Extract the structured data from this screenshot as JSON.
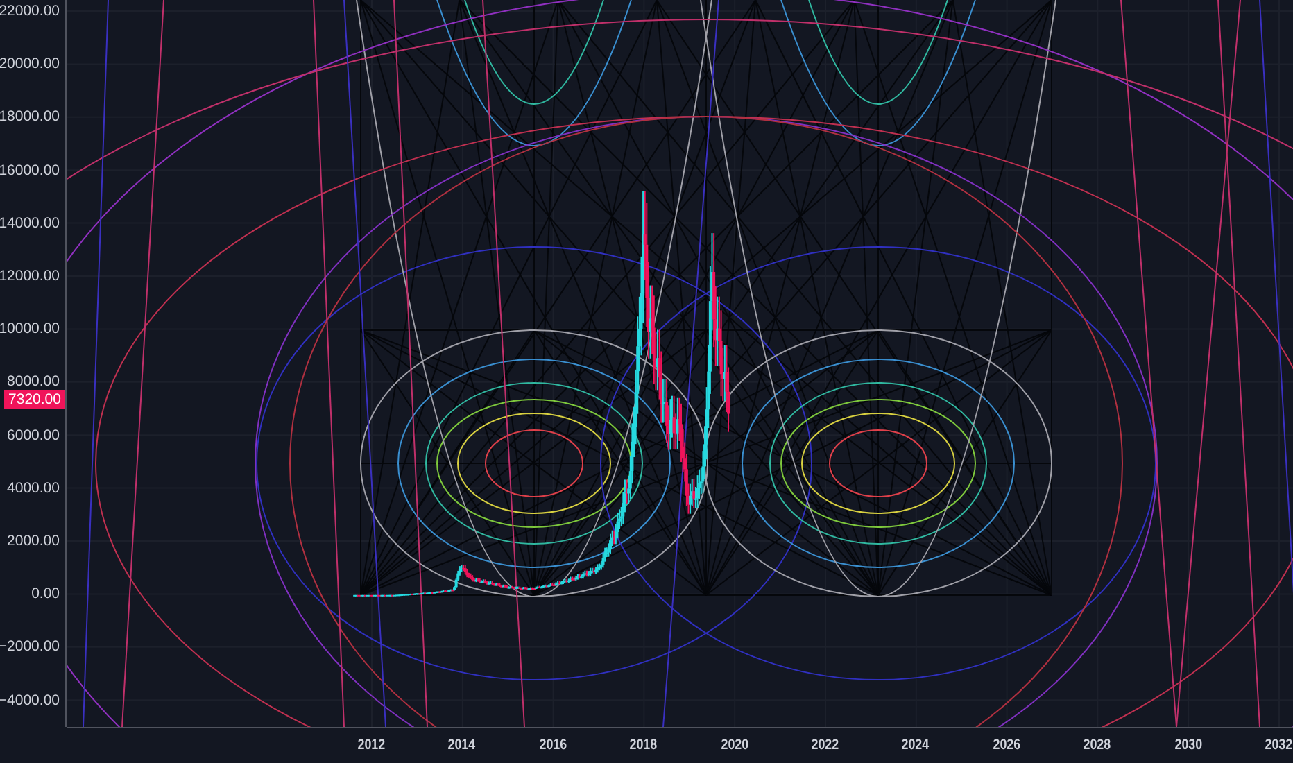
{
  "y_axis": {
    "labels": [
      "22000.00",
      "20000.00",
      "18000.00",
      "16000.00",
      "14000.00",
      "12000.00",
      "10000.00",
      "8000.00",
      "6000.00",
      "4000.00",
      "2000.00",
      "0.00",
      "−2000.00",
      "−4000.00"
    ]
  },
  "price_label": {
    "text": "7320.00"
  },
  "x_axis": {
    "labels": [
      "2012",
      "2014",
      "2016",
      "2018",
      "2020",
      "2022",
      "2024",
      "2026",
      "2028",
      "2030",
      "2032"
    ]
  }
}
